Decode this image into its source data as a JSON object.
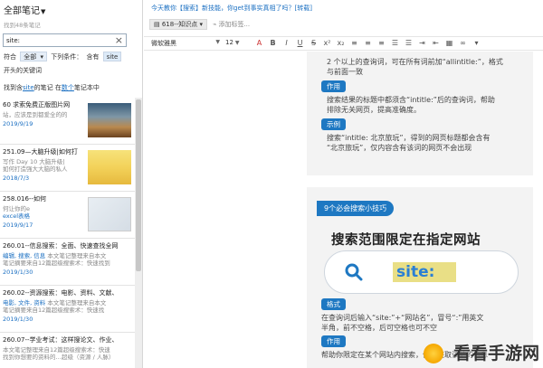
{
  "sidebar": {
    "title": "全部笔记",
    "found_count_text": "找到48条笔记",
    "search": {
      "value": "site:",
      "placeholder": ""
    },
    "filter": {
      "label1": "符合",
      "scope": "全部",
      "label2": "下列条件：",
      "cond": "含有",
      "value": "site"
    },
    "keyword_line": "开头的关键词",
    "result_prefix": "找到含",
    "result_link": "site",
    "result_mid": "的笔记 在",
    "result_link2": "数个",
    "result_suffix": "笔记本中",
    "notes": [
      {
        "title": "60 求索免费正版图片网",
        "snippet1": "站，应该是到都爱全的的",
        "snippet2": "",
        "date": "2019/9/19",
        "thumb": "mountain"
      },
      {
        "title": "251.09—大脑升级|如何打",
        "snippet1": "写作  Day 10 大脑升级|",
        "snippet2": "如何打造强大大脑的私人",
        "date": "2018/7/3",
        "thumb": "yellow-card"
      },
      {
        "title": "258.016--如何",
        "snippet1": "何让你的e",
        "snippet2": "excel表格",
        "date": "2019/9/17",
        "thumb": "gray-card"
      },
      {
        "title": "260.01--信息搜索：全面、快速查找全网",
        "tags": "编辑, 搜索, 信息",
        "snippet1": "本文笔记整理来自本文",
        "snippet2": "笔记摘要来自12篇超级搜索术：快速找到",
        "date": "2019/1/30"
      },
      {
        "title": "260.02--资源搜索：电影、资料、文献、",
        "tags": "电影, 文件, 资料",
        "snippet1": "本文笔记整理来自本文",
        "snippet2": "笔记摘要来自12篇超级搜索术：快速找",
        "date": "2019/1/30"
      },
      {
        "title": "260.07--学业考试：这样搜论文、作业、",
        "tags": "",
        "snippet1": "本文笔记整理来自12篇超级搜索术：快速",
        "snippet2": "找到你想要的资料的…超级（资源 / 人脉）",
        "date": ""
      }
    ]
  },
  "editor": {
    "top_title": "今天教你【搜索】新技能，你get到事实真相了吗？[转载]",
    "notebook_tag": "618--知识点",
    "add_tag": "添加标签...",
    "font": "微软雅黑",
    "size": "12",
    "toolbar_icons": [
      "color-icon",
      "bold-icon",
      "italic-icon",
      "underline-icon",
      "strikethrough-icon",
      "superscript-icon",
      "subscript-icon",
      "align-left-icon",
      "align-center-icon",
      "align-right-icon",
      "list-icon",
      "numbered-list-icon",
      "indent-icon",
      "outdent-icon",
      "table-icon",
      "link-icon",
      "more-icon"
    ],
    "card1": {
      "line1": "2 个以上的查询词，可在所有词前加“allintitle:”，格式",
      "line2": "与前面一致",
      "chip1": "作用",
      "line3": "搜索结果的标题中都须含“intitle:”后的查询词，帮助",
      "line4": "排除无关网页，提高准确度。",
      "chip2": "示例",
      "line5": "搜索“intitle: 北京旅玩”，得到的网页标题都会含有",
      "line6": "“北京旅玩”，仅内容含有该词的网页不会出现"
    },
    "card2": {
      "banner": "9个必会搜索小技巧",
      "headline": "搜索范围限定在指定网站",
      "site_text": "site:",
      "chip": "格式",
      "line1": "在查询词后输入“site:”+“网站名”，冒号“:”用英文",
      "line2": "半角，前不空格，后可空格也可不空",
      "chip2": "作用",
      "line3": "帮助你限定在某个网站内搜索，优先获取该站的信息"
    },
    "watermark": "看看手游网"
  }
}
